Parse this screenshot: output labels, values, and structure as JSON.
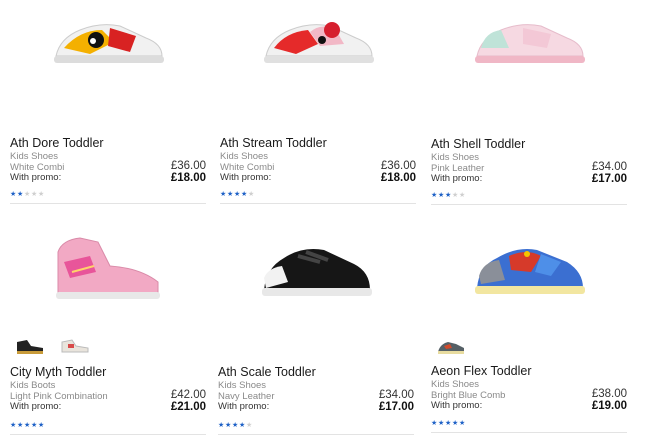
{
  "products": [
    {
      "name": "Ath Dore Toddler",
      "category": "Kids Shoes",
      "color": "White Combi",
      "promo_label": "With promo:",
      "price": "£36.00",
      "promo_price": "£18.00",
      "rating": 2,
      "stars": "★★★★★"
    },
    {
      "name": "Ath Stream Toddler",
      "category": "Kids Shoes",
      "color": "White Combi",
      "promo_label": "With promo:",
      "price": "£36.00",
      "promo_price": "£18.00",
      "rating": 4,
      "stars": "★★★★★"
    },
    {
      "name": "Ath Shell Toddler",
      "category": "Kids Shoes",
      "color": "Pink Leather",
      "promo_label": "With promo:",
      "price": "£34.00",
      "promo_price": "£17.00",
      "rating": 3,
      "stars": "★★★★★"
    },
    {
      "name": "City Myth Toddler",
      "category": "Kids Boots",
      "color": "Light Pink Combination",
      "promo_label": "With promo:",
      "price": "£42.00",
      "promo_price": "£21.00",
      "rating": 5,
      "stars": "★★★★★"
    },
    {
      "name": "Ath Scale Toddler",
      "category": "Kids Shoes",
      "color": "Navy Leather",
      "promo_label": "With promo:",
      "price": "£34.00",
      "promo_price": "£17.00",
      "rating": 4,
      "stars": "★★★★★"
    },
    {
      "name": "Aeon Flex Toddler",
      "category": "Kids Shoes",
      "color": "Bright Blue Comb",
      "promo_label": "With promo:",
      "price": "£38.00",
      "promo_price": "£19.00",
      "rating": 5,
      "stars": "★★★★★"
    }
  ],
  "colors": {
    "star_filled": "#1f62c7",
    "star_empty": "#cfcfcf"
  }
}
